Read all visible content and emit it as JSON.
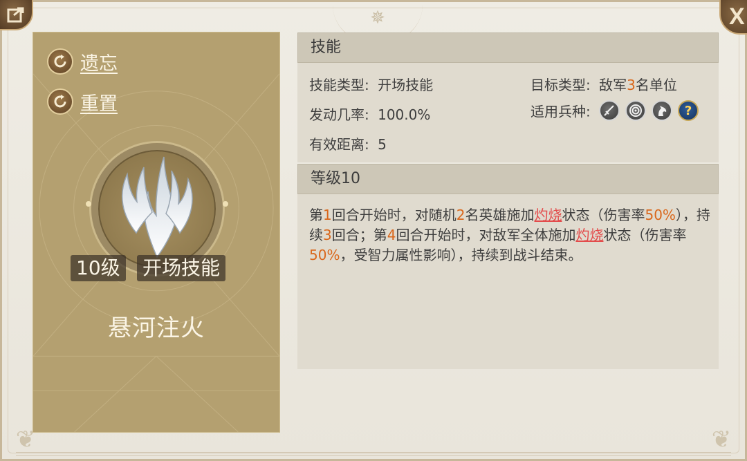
{
  "left_panel": {
    "actions": [
      {
        "label": "遗忘",
        "icon": "refresh-icon"
      },
      {
        "label": "重置",
        "icon": "refresh-icon"
      }
    ],
    "skill_icon": "white-flame-icon",
    "level_tag": "10级",
    "type_tag": "开场技能",
    "skill_name": "悬河注火"
  },
  "skill_section": {
    "header": "技能",
    "skill_type_label": "技能类型:",
    "skill_type_value": "开场技能",
    "target_type_label": "目标类型:",
    "target_type_prefix": "敌军",
    "target_type_count": "3",
    "target_type_suffix": "名单位",
    "trigger_rate_label": "发动几率:",
    "trigger_rate_value": "100.0%",
    "unit_types_label": "适用兵种:",
    "unit_types": [
      "sword-icon",
      "bow-target-icon",
      "horse-icon",
      "question-icon"
    ],
    "unit_question_mark": "?",
    "range_label": "有效距离:",
    "range_value": "5"
  },
  "level_section": {
    "header": "等级10",
    "description": {
      "p1": "第",
      "n1": "1",
      "p2": "回合开始时，对随机",
      "n2": "2",
      "p3": "名英雄施加",
      "k1": "灼烧",
      "p4": "状态（伤害率",
      "n3": "50%",
      "p5": "），持续",
      "n4": "3",
      "p6": "回合；第",
      "n5": "4",
      "p7": "回合开始时，对敌军全体施加",
      "k2": "灼烧",
      "p8": "状态（伤害率",
      "n6": "50%",
      "p9": "，受智力属性影响），持续到战斗结束。"
    }
  },
  "window": {
    "close_label": "X"
  },
  "colors": {
    "highlight_number": "#d9671b",
    "keyword_red": "#e34b4b",
    "card_gold": "#b4a070"
  }
}
